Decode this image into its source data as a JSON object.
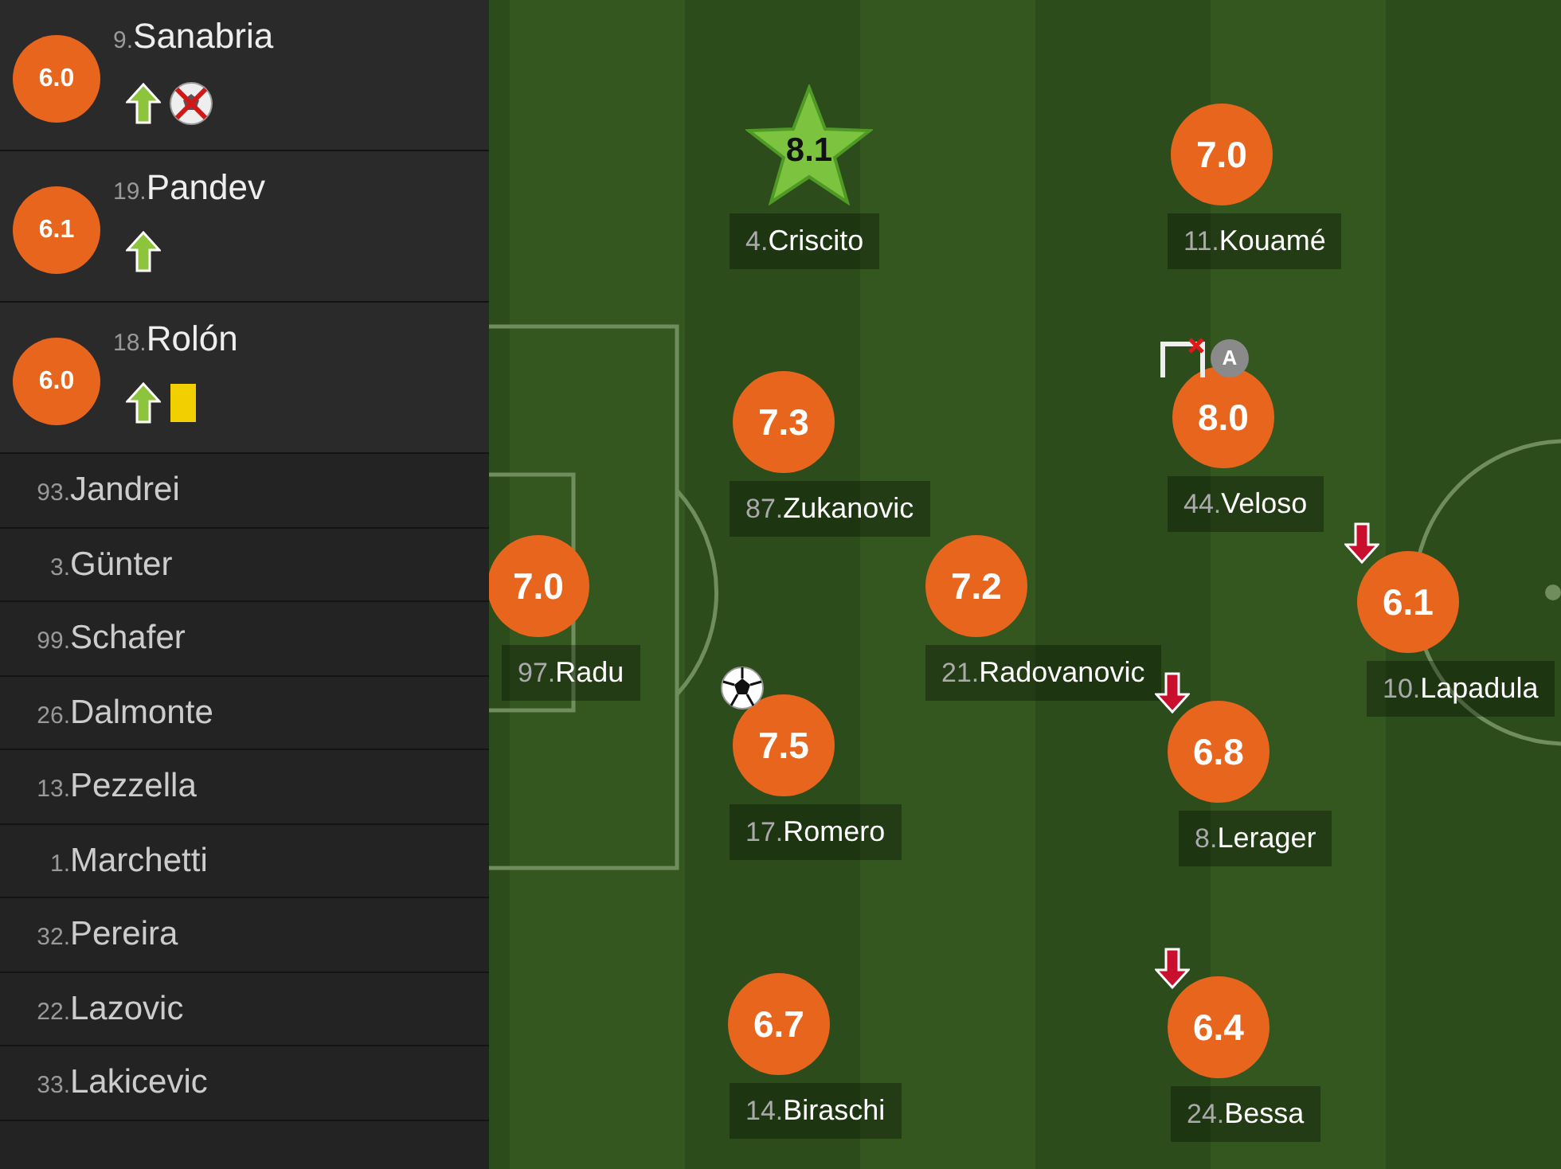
{
  "substitutes_used": [
    {
      "number": "9.",
      "name": "Sanabria",
      "rating": "6.0",
      "events": [
        {
          "kind": "sub_in"
        },
        {
          "kind": "missed_chance"
        }
      ]
    },
    {
      "number": "19.",
      "name": "Pandev",
      "rating": "6.1",
      "events": [
        {
          "kind": "sub_in"
        }
      ]
    },
    {
      "number": "18.",
      "name": "Rolón",
      "rating": "6.0",
      "events": [
        {
          "kind": "sub_in"
        },
        {
          "kind": "yellow_card"
        }
      ]
    }
  ],
  "substitutes_unused": [
    {
      "number": "93.",
      "name": "Jandrei"
    },
    {
      "number": "3.",
      "name": "Günter"
    },
    {
      "number": "99.",
      "name": "Schafer"
    },
    {
      "number": "26.",
      "name": "Dalmonte"
    },
    {
      "number": "13.",
      "name": "Pezzella"
    },
    {
      "number": "1.",
      "name": "Marchetti"
    },
    {
      "number": "32.",
      "name": "Pereira"
    },
    {
      "number": "22.",
      "name": "Lazovic"
    },
    {
      "number": "33.",
      "name": "Lakicevic"
    }
  ],
  "pitch": {
    "players": [
      {
        "number": "4.",
        "name": "Criscito",
        "rating": "8.1",
        "star": true
      },
      {
        "number": "11.",
        "name": "Kouamé",
        "rating": "7.0",
        "star": false
      },
      {
        "number": "87.",
        "name": "Zukanovic",
        "rating": "7.3",
        "star": false
      },
      {
        "number": "44.",
        "name": "Veloso",
        "rating": "8.0",
        "star": false,
        "events": [
          {
            "kind": "woodwork"
          },
          {
            "kind": "assist",
            "label": "A"
          }
        ]
      },
      {
        "number": "97.",
        "name": "Radu",
        "rating": "7.0",
        "star": false
      },
      {
        "number": "21.",
        "name": "Radovanovic",
        "rating": "7.2",
        "star": false
      },
      {
        "number": "10.",
        "name": "Lapadula",
        "rating": "6.1",
        "star": false,
        "events": [
          {
            "kind": "sub_out"
          }
        ]
      },
      {
        "number": "17.",
        "name": "Romero",
        "rating": "7.5",
        "star": false,
        "events": [
          {
            "kind": "goal"
          }
        ]
      },
      {
        "number": "8.",
        "name": "Lerager",
        "rating": "6.8",
        "star": false,
        "events": [
          {
            "kind": "sub_out"
          }
        ]
      },
      {
        "number": "14.",
        "name": "Biraschi",
        "rating": "6.7",
        "star": false
      },
      {
        "number": "24.",
        "name": "Bessa",
        "rating": "6.4",
        "star": false,
        "events": [
          {
            "kind": "sub_out"
          }
        ]
      }
    ]
  }
}
